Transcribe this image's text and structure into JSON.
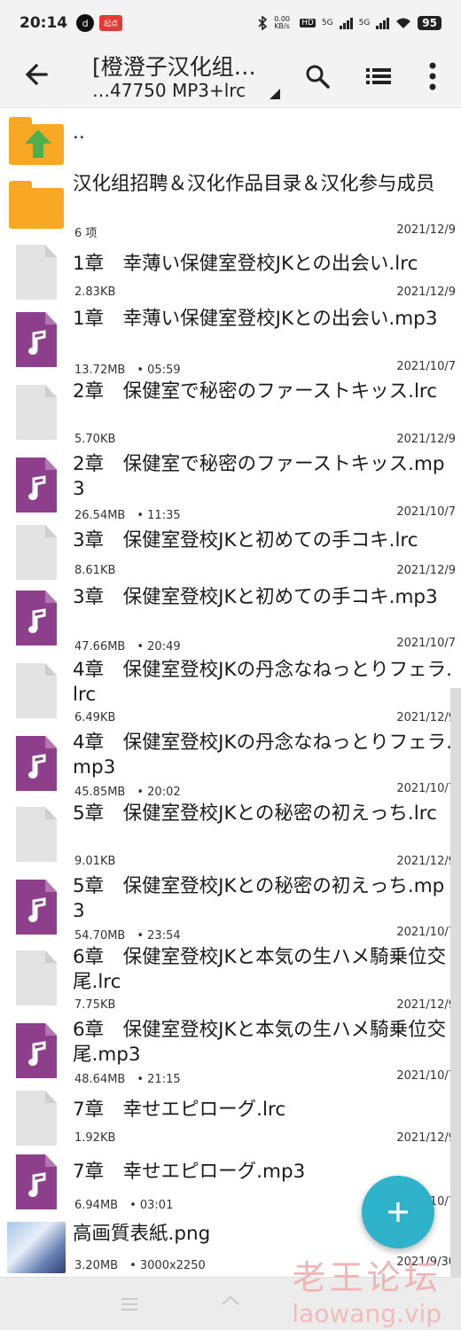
{
  "status_bar": {
    "time": "20:14",
    "tiktok_icon": "d",
    "app_badge": "起点",
    "net_speed": "0.00\nKB/s",
    "hd_label": "HD",
    "signal1": "5G",
    "signal2": "5G",
    "battery": "95"
  },
  "toolbar": {
    "title": "[橙澄子汉化组…",
    "subtitle": "…47750 MP3+lrc"
  },
  "files": [
    {
      "name": "..",
      "meta_left": "",
      "meta_right": "",
      "type": "parent"
    },
    {
      "name": "汉化组招聘＆汉化作品目录＆汉化参与成员",
      "meta_left": "6 项",
      "meta_right": "2021/12/9",
      "type": "folder"
    },
    {
      "name": "1章　幸薄い保健室登校JKとの出会い.lrc",
      "meta_left": "2.83KB",
      "meta_right": "2021/12/9",
      "type": "doc"
    },
    {
      "name": "1章　幸薄い保健室登校JKとの出会い.mp3",
      "meta_left": "13.72MB　• 05:59",
      "meta_right": "2021/10/7",
      "type": "music"
    },
    {
      "name": "2章　保健室で秘密のファーストキッス.lrc",
      "meta_left": "5.70KB",
      "meta_right": "2021/12/9",
      "type": "doc"
    },
    {
      "name": "2章　保健室で秘密のファーストキッス.mp3",
      "meta_left": "26.54MB　• 11:35",
      "meta_right": "2021/10/7",
      "type": "music"
    },
    {
      "name": "3章　保健室登校JKと初めての手コキ.lrc",
      "meta_left": "8.61KB",
      "meta_right": "2021/12/9",
      "type": "doc"
    },
    {
      "name": "3章　保健室登校JKと初めての手コキ.mp3",
      "meta_left": "47.66MB　• 20:49",
      "meta_right": "2021/10/7",
      "type": "music"
    },
    {
      "name": "4章　保健室登校JKの丹念なねっとりフェラ.lrc",
      "meta_left": "6.49KB",
      "meta_right": "2021/12/9",
      "type": "doc"
    },
    {
      "name": "4章　保健室登校JKの丹念なねっとりフェラ.mp3",
      "meta_left": "45.85MB　• 20:02",
      "meta_right": "2021/10/7",
      "type": "music"
    },
    {
      "name": "5章　保健室登校JKとの秘密の初えっち.lrc",
      "meta_left": "9.01KB",
      "meta_right": "2021/12/9",
      "type": "doc"
    },
    {
      "name": "5章　保健室登校JKとの秘密の初えっち.mp3",
      "meta_left": "54.70MB　• 23:54",
      "meta_right": "2021/10/7",
      "type": "music"
    },
    {
      "name": "6章　保健室登校JKと本気の生ハメ騎乗位交尾.lrc",
      "meta_left": "7.75KB",
      "meta_right": "2021/12/9",
      "type": "doc"
    },
    {
      "name": "6章　保健室登校JKと本気の生ハメ騎乗位交尾.mp3",
      "meta_left": "48.64MB　• 21:15",
      "meta_right": "2021/10/7",
      "type": "music"
    },
    {
      "name": "7章　幸せエピローグ.lrc",
      "meta_left": "1.92KB",
      "meta_right": "2021/12/9",
      "type": "doc"
    },
    {
      "name": "7章　幸せエピローグ.mp3",
      "meta_left": "6.94MB　• 03:01",
      "meta_right": "2021/10/7",
      "type": "music"
    },
    {
      "name": "高画質表紙.png",
      "meta_left": "3.20MB　• 3000x2250",
      "meta_right": "2021/9/30",
      "type": "image"
    }
  ],
  "watermark": {
    "cn": "老王论坛",
    "en": "laowang.vip"
  },
  "icons": {
    "back": "arrow-left-icon",
    "search": "search-icon",
    "list": "list-view-icon",
    "more": "more-vert-icon",
    "fab": "plus-icon"
  },
  "colors": {
    "folder": "#f9a825",
    "music": "#8e3f8c",
    "fab": "#2fb3cb",
    "up_arrow": "#4caf50"
  }
}
